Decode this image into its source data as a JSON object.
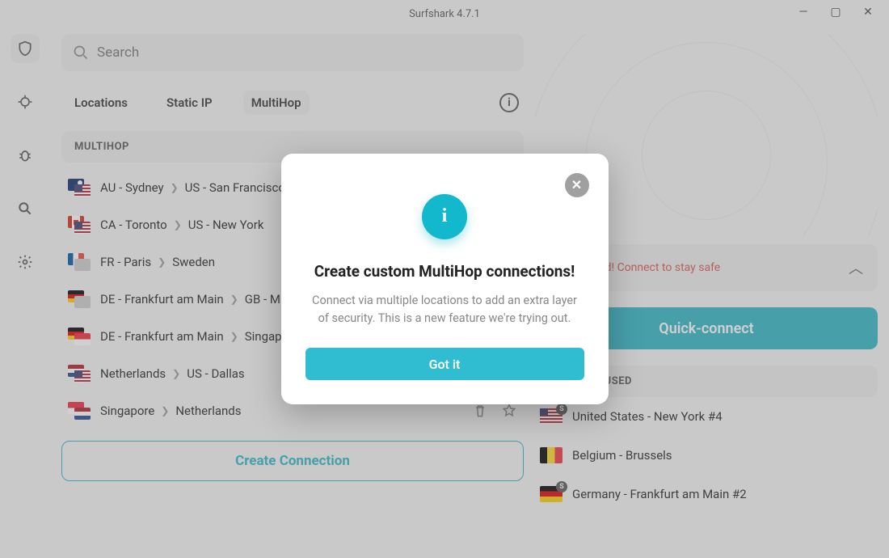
{
  "window": {
    "title": "Surfshark 4.7.1"
  },
  "search": {
    "placeholder": "Search"
  },
  "tabs": {
    "locations": "Locations",
    "static_ip": "Static IP",
    "multihop": "MultiHop"
  },
  "section": {
    "multihop_header": "MULTIHOP"
  },
  "routes": [
    {
      "from": "AU - Sydney",
      "to": "US - San Francisco",
      "f1": "au",
      "f2": "us"
    },
    {
      "from": "CA - Toronto",
      "to": "US - New York",
      "f1": "ca",
      "f2": "us"
    },
    {
      "from": "FR - Paris",
      "to": "Sweden",
      "f1": "fr",
      "f2": "se"
    },
    {
      "from": "DE - Frankfurt am Main",
      "to": "GB - M",
      "f1": "de",
      "f2": "gb"
    },
    {
      "from": "DE - Frankfurt am Main",
      "to": "Singap",
      "f1": "de",
      "f2": "sg"
    },
    {
      "from": "Netherlands",
      "to": "US - Dallas",
      "f1": "nl",
      "f2": "us",
      "custom": true
    },
    {
      "from": "Singapore",
      "to": "Netherlands",
      "f1": "sg",
      "f2": "nl",
      "custom": true
    }
  ],
  "create_connection": "Create Connection",
  "warning": {
    "text": "Unprotected! Connect to stay safe"
  },
  "quick_connect": "Quick-connect",
  "recent": {
    "header": "RECENTLY USED",
    "items": [
      {
        "label": "United States - New York #4",
        "flag": "us",
        "static": true
      },
      {
        "label": "Belgium - Brussels",
        "flag": "be",
        "static": false
      },
      {
        "label": "Germany - Frankfurt am Main #2",
        "flag": "de",
        "static": true
      }
    ]
  },
  "modal": {
    "title": "Create custom MultiHop connections!",
    "body": "Connect via multiple locations to add an extra layer of security. This is a new feature we're trying out.",
    "button": "Got it"
  }
}
